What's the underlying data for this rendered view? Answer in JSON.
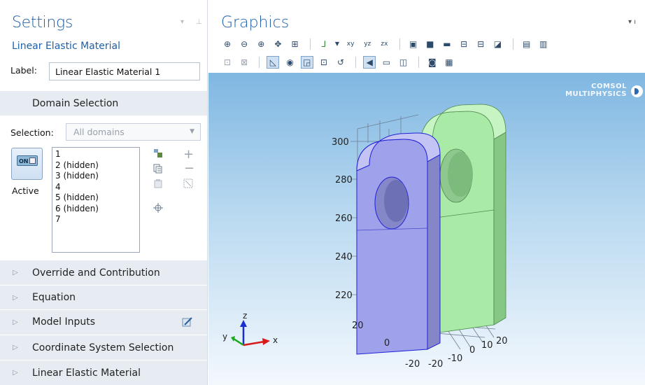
{
  "settings": {
    "title": "Settings",
    "subtitle": "Linear Elastic Material",
    "label_caption": "Label:",
    "label_value": "Linear Elastic Material 1",
    "domain_section": "Domain Selection",
    "selection_caption": "Selection:",
    "selection_value": "All domains",
    "active_toggle": "ON",
    "active_label": "Active",
    "domains": [
      "1",
      "2 (hidden)",
      "3 (hidden)",
      "4",
      "5 (hidden)",
      "6 (hidden)",
      "7"
    ],
    "sections": [
      "Override and Contribution",
      "Equation",
      "Model Inputs",
      "Coordinate System Selection",
      "Linear Elastic Material"
    ]
  },
  "graphics": {
    "title": "Graphics",
    "brand_line1": "COMSOL",
    "brand_line2": "MULTIPHYSICS",
    "toolbar_row1": [
      "zoom-in",
      "zoom-out",
      "zoom-box",
      "zoom-selected",
      "zoom-extents",
      "|",
      "axis-view",
      "xy",
      "yz",
      "zx",
      "|",
      "scene-light",
      "wireframe-1",
      "wireframe-2",
      "wireframe-3",
      "wireframe-4",
      "hide",
      "|",
      "image-snapshot",
      "image-export"
    ],
    "toolbar_row2": [
      "select-box",
      "deselect-box",
      "|",
      "render-wire",
      "transparency",
      "show-hidden",
      "show-grid",
      "reset",
      "|",
      "selected-highlight",
      "selection-list",
      "material-view",
      "|",
      "camera",
      "print"
    ],
    "z_ticks": [
      "300",
      "280",
      "260",
      "240",
      "220"
    ],
    "x_ticks": [
      "20",
      "0",
      "-20"
    ],
    "y_ticks": [
      "-20",
      "-10",
      "0",
      "10",
      "20"
    ],
    "axis_labels": {
      "x": "x",
      "y": "y",
      "z": "z"
    },
    "colors": {
      "selected_domain": "#9fa1ea",
      "other_domain": "#a5eca3",
      "edge_highlight": "#1e1ee0"
    }
  }
}
